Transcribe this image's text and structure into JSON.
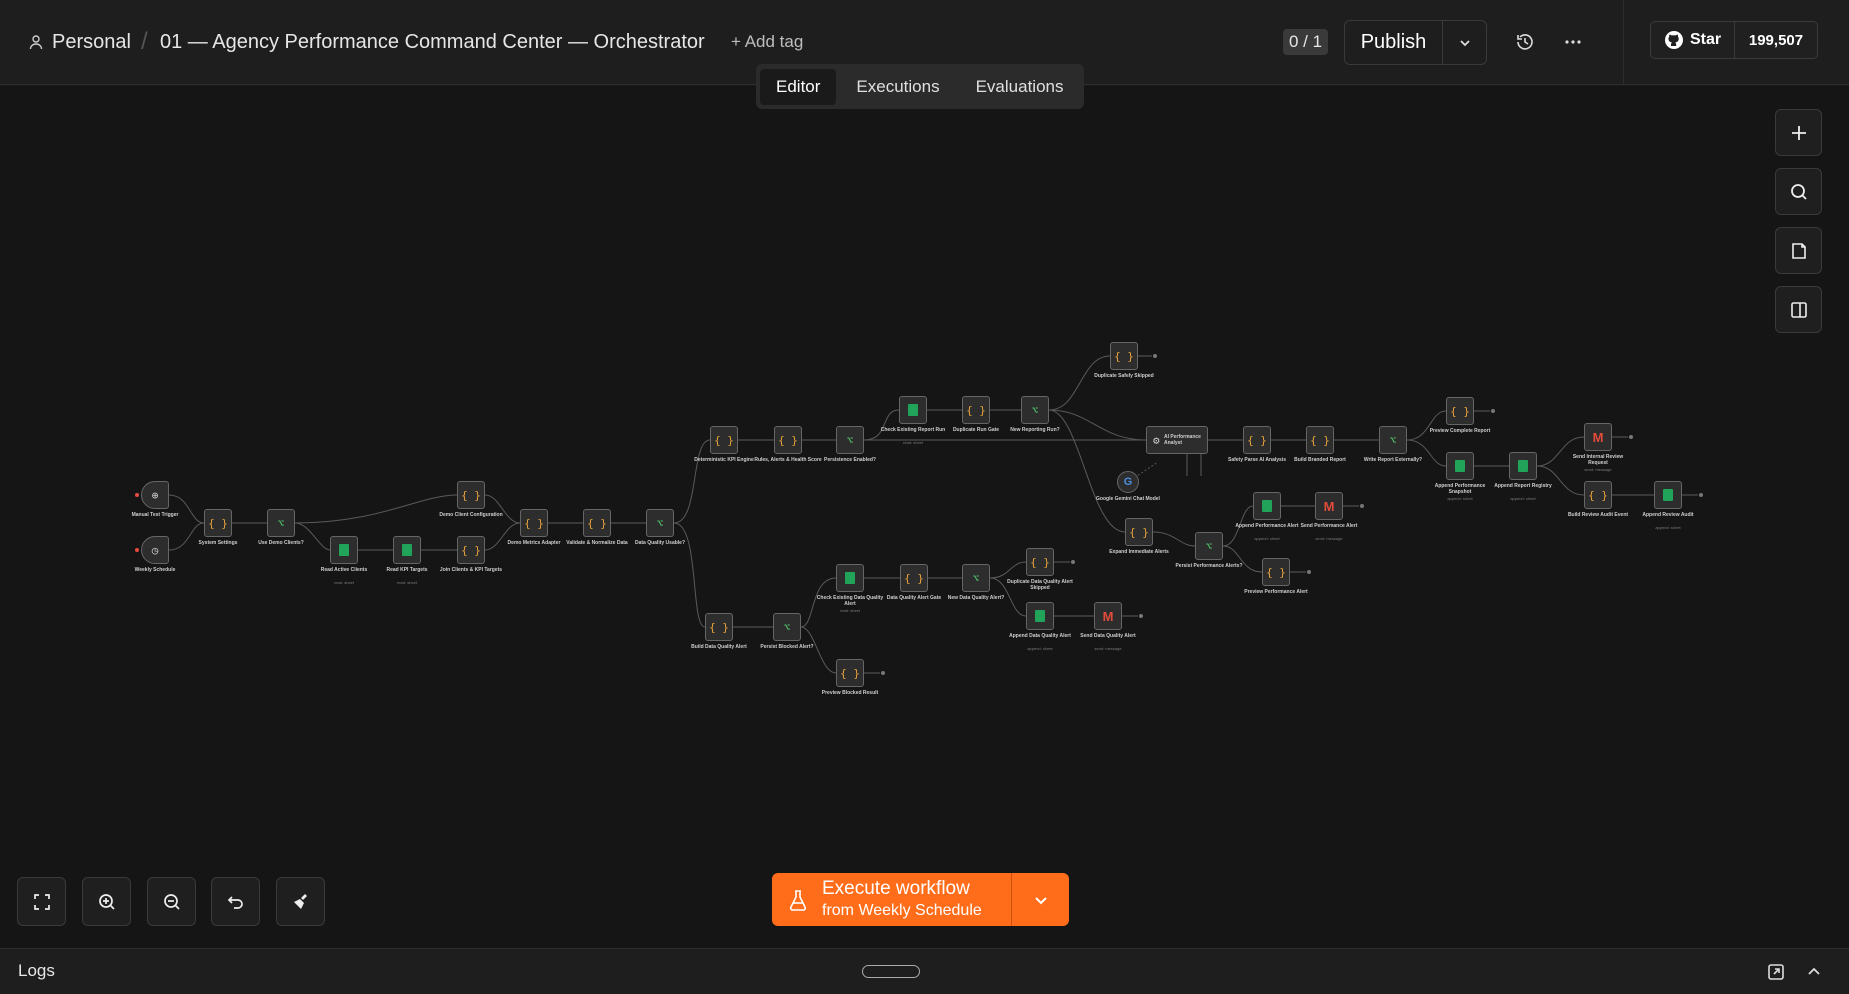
{
  "header": {
    "project": "Personal",
    "separator": "/",
    "workflow_title": "01 — Agency Performance Command Center — Orchestrator",
    "add_tag": "+ Add tag",
    "counter": "0 / 1",
    "publish_label": "Publish",
    "github_star_label": "Star",
    "github_star_count": "199,507"
  },
  "tabs": [
    {
      "label": "Editor",
      "active": true
    },
    {
      "label": "Executions",
      "active": false
    },
    {
      "label": "Evaluations",
      "active": false
    }
  ],
  "nodes": [
    {
      "id": "n1",
      "type": "trigger",
      "glyph": "⊕",
      "label": "Manual Test Trigger",
      "sub": ""
    },
    {
      "id": "n2",
      "type": "trigger",
      "glyph": "◷",
      "label": "Weekly Schedule",
      "sub": ""
    },
    {
      "id": "n3",
      "type": "code",
      "glyph": "{ }",
      "label": "System Settings",
      "sub": ""
    },
    {
      "id": "n4",
      "type": "if",
      "glyph": "⌥",
      "label": "Use Demo Clients?",
      "sub": ""
    },
    {
      "id": "n5",
      "type": "sheet",
      "glyph": "",
      "label": "Read Active Clients",
      "sub": "read: sheet"
    },
    {
      "id": "n6",
      "type": "sheet",
      "glyph": "",
      "label": "Read KPI Targets",
      "sub": "read: sheet"
    },
    {
      "id": "n7",
      "type": "code",
      "glyph": "{ }",
      "label": "Demo Client Configuration",
      "sub": ""
    },
    {
      "id": "n8",
      "type": "code",
      "glyph": "{ }",
      "label": "Join Clients & KPI Targets",
      "sub": ""
    },
    {
      "id": "n9",
      "type": "code",
      "glyph": "{ }",
      "label": "Demo Metrics Adapter",
      "sub": ""
    },
    {
      "id": "n10",
      "type": "code",
      "glyph": "{ }",
      "label": "Validate & Normalize Data",
      "sub": ""
    },
    {
      "id": "n11",
      "type": "if",
      "glyph": "⌥",
      "label": "Data Quality Usable?",
      "sub": ""
    },
    {
      "id": "n12",
      "type": "code",
      "glyph": "{ }",
      "label": "Deterministic KPI Engine",
      "sub": ""
    },
    {
      "id": "n13",
      "type": "code",
      "glyph": "{ }",
      "label": "Rules, Alerts & Health Score",
      "sub": ""
    },
    {
      "id": "n14",
      "type": "if",
      "glyph": "⌥",
      "label": "Persistence Enabled?",
      "sub": ""
    },
    {
      "id": "n15",
      "type": "sheet",
      "glyph": "",
      "label": "Check Existing Report Run",
      "sub": "read: sheet"
    },
    {
      "id": "n16",
      "type": "code",
      "glyph": "{ }",
      "label": "Duplicate Run Gate",
      "sub": ""
    },
    {
      "id": "n17",
      "type": "if",
      "glyph": "⌥",
      "label": "New Reporting Run?",
      "sub": ""
    },
    {
      "id": "n18",
      "type": "code",
      "glyph": "{ }",
      "label": "Duplicate Safely Skipped",
      "sub": ""
    },
    {
      "id": "n19",
      "type": "agent",
      "glyph": "⚙",
      "label": "AI Performance Analyst",
      "sub": ""
    },
    {
      "id": "n20",
      "type": "model",
      "glyph": "G",
      "label": "Google Gemini Chat Model",
      "sub": ""
    },
    {
      "id": "n21",
      "type": "code",
      "glyph": "{ }",
      "label": "Safety Parse AI Analysis",
      "sub": ""
    },
    {
      "id": "n22",
      "type": "code",
      "glyph": "{ }",
      "label": "Build Branded Report",
      "sub": ""
    },
    {
      "id": "n23",
      "type": "if",
      "glyph": "⌥",
      "label": "Write Report Externally?",
      "sub": ""
    },
    {
      "id": "n24",
      "type": "code",
      "glyph": "{ }",
      "label": "Preview Complete Report",
      "sub": ""
    },
    {
      "id": "n25",
      "type": "sheet",
      "glyph": "",
      "label": "Append Performance Snapshot",
      "sub": "append: sheet"
    },
    {
      "id": "n26",
      "type": "sheet",
      "glyph": "",
      "label": "Append Report Registry",
      "sub": "append: sheet"
    },
    {
      "id": "n27",
      "type": "mail",
      "glyph": "M",
      "label": "Send Internal Review Request",
      "sub": "send: message"
    },
    {
      "id": "n28",
      "type": "code",
      "glyph": "{ }",
      "label": "Build Review Audit Event",
      "sub": ""
    },
    {
      "id": "n29",
      "type": "sheet",
      "glyph": "",
      "label": "Append Review Audit",
      "sub": "append: sheet"
    },
    {
      "id": "n30",
      "type": "code",
      "glyph": "{ }",
      "label": "Expand Immediate Alerts",
      "sub": ""
    },
    {
      "id": "n31",
      "type": "if",
      "glyph": "⌥",
      "label": "Persist Performance Alerts?",
      "sub": ""
    },
    {
      "id": "n32",
      "type": "sheet",
      "glyph": "",
      "label": "Append Performance Alert",
      "sub": "append: sheet"
    },
    {
      "id": "n33",
      "type": "mail",
      "glyph": "M",
      "label": "Send Performance Alert",
      "sub": "send: message"
    },
    {
      "id": "n34",
      "type": "code",
      "glyph": "{ }",
      "label": "Preview Performance Alert",
      "sub": ""
    },
    {
      "id": "n35",
      "type": "code",
      "glyph": "{ }",
      "label": "Build Data Quality Alert",
      "sub": ""
    },
    {
      "id": "n36",
      "type": "if",
      "glyph": "⌥",
      "label": "Persist Blocked Alert?",
      "sub": ""
    },
    {
      "id": "n37",
      "type": "code",
      "glyph": "{ }",
      "label": "Preview Blocked Result",
      "sub": ""
    },
    {
      "id": "n38",
      "type": "sheet",
      "glyph": "",
      "label": "Check Existing Data Quality Alert",
      "sub": "read: sheet"
    },
    {
      "id": "n39",
      "type": "code",
      "glyph": "{ }",
      "label": "Data Quality Alert Gate",
      "sub": ""
    },
    {
      "id": "n40",
      "type": "if",
      "glyph": "⌥",
      "label": "New Data Quality Alert?",
      "sub": ""
    },
    {
      "id": "n41",
      "type": "code",
      "glyph": "{ }",
      "label": "Duplicate Data Quality Alert Skipped",
      "sub": ""
    },
    {
      "id": "n42",
      "type": "sheet",
      "glyph": "",
      "label": "Append Data Quality Alert",
      "sub": "append: sheet"
    },
    {
      "id": "n43",
      "type": "mail",
      "glyph": "M",
      "label": "Send Data Quality Alert",
      "sub": "send: message"
    }
  ],
  "execute": {
    "title": "Execute workflow",
    "subtitle": "from Weekly Schedule"
  },
  "logs": {
    "title": "Logs"
  },
  "colors": {
    "accent": "#ff6d1a",
    "canvas": "#151515",
    "code": "#e8a23c",
    "if": "#4fc36a",
    "sheets": "#22a35a",
    "gmail": "#e34b3b"
  }
}
